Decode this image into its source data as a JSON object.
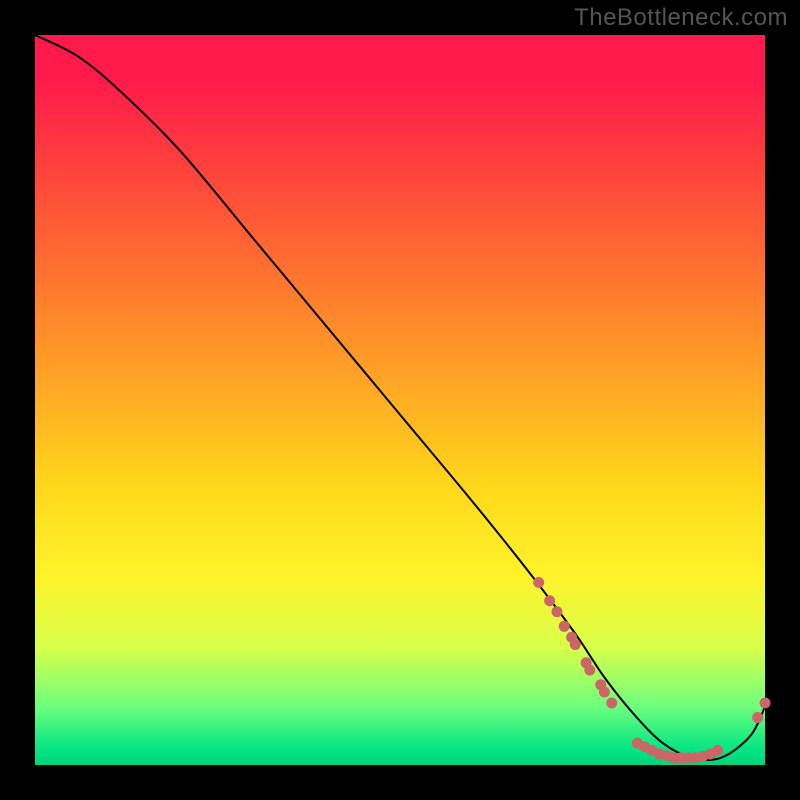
{
  "watermark": "TheBottleneck.com",
  "chart_data": {
    "type": "line",
    "title": "",
    "xlabel": "",
    "ylabel": "",
    "xlim": [
      0,
      100
    ],
    "ylim": [
      0,
      100
    ],
    "grid": false,
    "legend": false,
    "series": [
      {
        "name": "bottleneck-curve",
        "color": "#000000",
        "x": [
          0,
          6,
          12,
          20,
          30,
          40,
          50,
          60,
          68,
          74,
          78,
          82,
          86,
          90,
          94,
          98,
          100
        ],
        "y": [
          100,
          97,
          92,
          84,
          72,
          60,
          48,
          36,
          26,
          18,
          12,
          7,
          3,
          1,
          1,
          4,
          8
        ]
      }
    ],
    "markers": [
      {
        "name": "cluster-descend",
        "color": "#cc6666",
        "points": [
          {
            "x": 69.0,
            "y": 25.0
          },
          {
            "x": 70.5,
            "y": 22.5
          },
          {
            "x": 71.5,
            "y": 21.0
          },
          {
            "x": 72.5,
            "y": 19.0
          },
          {
            "x": 73.5,
            "y": 17.5
          },
          {
            "x": 74.0,
            "y": 16.5
          },
          {
            "x": 75.5,
            "y": 14.0
          },
          {
            "x": 76.0,
            "y": 13.0
          },
          {
            "x": 77.5,
            "y": 11.0
          },
          {
            "x": 78.0,
            "y": 10.0
          },
          {
            "x": 79.0,
            "y": 8.5
          }
        ]
      },
      {
        "name": "cluster-trough",
        "color": "#cc6666",
        "points": [
          {
            "x": 82.5,
            "y": 3.0
          },
          {
            "x": 83.5,
            "y": 2.5
          },
          {
            "x": 84.5,
            "y": 2.0
          },
          {
            "x": 85.5,
            "y": 1.5
          },
          {
            "x": 86.5,
            "y": 1.3
          },
          {
            "x": 87.5,
            "y": 1.0
          },
          {
            "x": 88.5,
            "y": 1.0
          },
          {
            "x": 89.5,
            "y": 1.0
          },
          {
            "x": 90.5,
            "y": 1.0
          },
          {
            "x": 91.5,
            "y": 1.2
          },
          {
            "x": 92.5,
            "y": 1.5
          },
          {
            "x": 93.5,
            "y": 2.0
          }
        ]
      },
      {
        "name": "cluster-rise",
        "color": "#cc6666",
        "points": [
          {
            "x": 99.0,
            "y": 6.5
          },
          {
            "x": 100.0,
            "y": 8.5
          }
        ]
      }
    ]
  }
}
